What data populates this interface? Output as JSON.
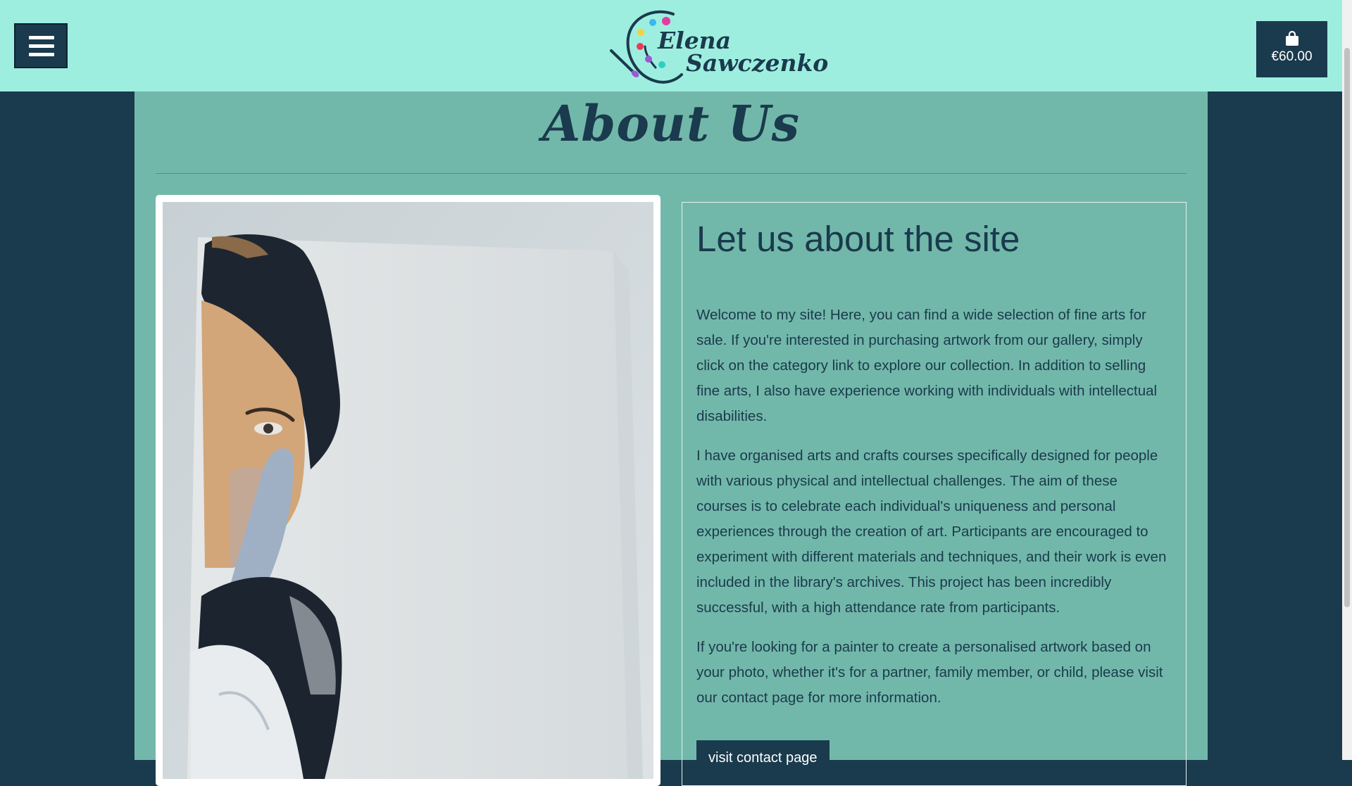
{
  "header": {
    "menu_icon": "hamburger-menu-icon",
    "logo": {
      "first_name": "Elena",
      "last_name": "Sawczenko",
      "icon": "paint-palette-brush-icon"
    },
    "cart": {
      "icon": "shopping-bag-icon",
      "total": "€60.00"
    }
  },
  "main": {
    "title": "About Us",
    "card": {
      "heading": "Let us about the site",
      "paragraphs": [
        "Welcome to my site! Here, you can find a wide selection of fine arts for sale. If you're interested in purchasing artwork from our gallery, simply click on the category link to explore our collection. In addition to selling fine arts, I also have experience working with individuals with intellectual disabilities.",
        "I have organised arts and crafts courses specifically designed for people with various physical and intellectual challenges. The aim of these courses is to celebrate each individual's uniqueness and personal experiences through the creation of art. Participants are encouraged to experiment with different materials and techniques, and their work is even included in the library's archives. This project has been incredibly successful, with a high attendance rate from participants.",
        "If you're looking for a painter to create a personalised artwork based on your photo, whether it's for a partner, family member, or child, please visit our contact page for more information."
      ],
      "button_label": "visit contact page"
    }
  },
  "colors": {
    "header_bg": "#9eeedf",
    "navy": "#1a3a4d",
    "content_bg": "#72b8aa",
    "palette_dots": [
      "#e23ca3",
      "#3bb7ec",
      "#f3d33a",
      "#ec3a5b",
      "#9a57d8",
      "#2fd0c4",
      "#36a8e0"
    ]
  }
}
